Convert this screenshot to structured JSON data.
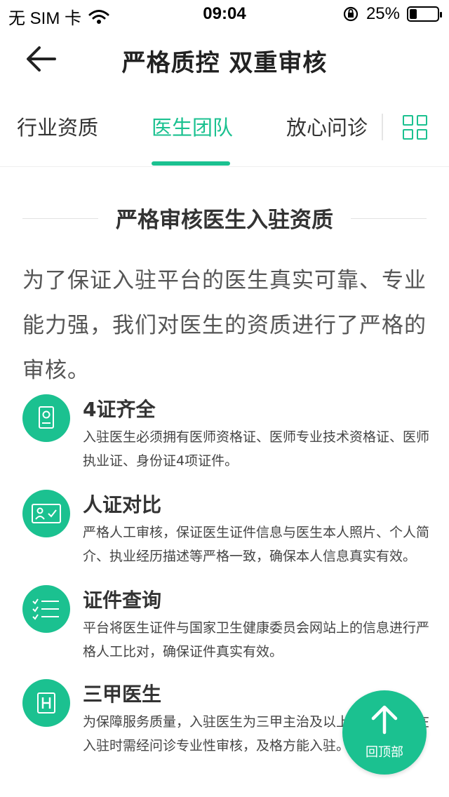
{
  "status_bar": {
    "carrier": "无 SIM 卡",
    "time": "09:04",
    "battery": "25%",
    "battery_level": 0.25
  },
  "nav": {
    "title": "严格质控 双重审核"
  },
  "tabs": [
    {
      "label": "行业资质",
      "active": false
    },
    {
      "label": "医生团队",
      "active": true
    },
    {
      "label": "放心问诊",
      "active": false
    }
  ],
  "section": {
    "heading": "严格审核医生入驻资质",
    "intro": "为了保证入驻平台的医生真实可靠、专业能力强，我们对医生的资质进行了严格的审核。"
  },
  "features": [
    {
      "icon": "certificate-icon",
      "title": "4证齐全",
      "desc": "入驻医生必须拥有医师资格证、医师专业技术资格证、医师执业证、身份证4项证件。"
    },
    {
      "icon": "id-verify-icon",
      "title": "人证对比",
      "desc": "严格人工审核，保证医生证件信息与医生本人照片、个人简介、执业经历描述等严格一致，确保本人信息真实有效。"
    },
    {
      "icon": "checklist-icon",
      "title": "证件查询",
      "desc": "平台将医生证件与国家卫生健康委员会网站上的信息进行严格人工比对，确保证件真实有效。"
    },
    {
      "icon": "hospital-icon",
      "title": "三甲医生",
      "desc": "为保障服务质量，入驻医生为三甲主治及以上职称，同时在入驻时需经问诊专业性审核，及格方能入驻。"
    }
  ],
  "back_to_top": {
    "label": "回顶部"
  },
  "colors": {
    "accent": "#1bc190",
    "text": "#333333"
  }
}
